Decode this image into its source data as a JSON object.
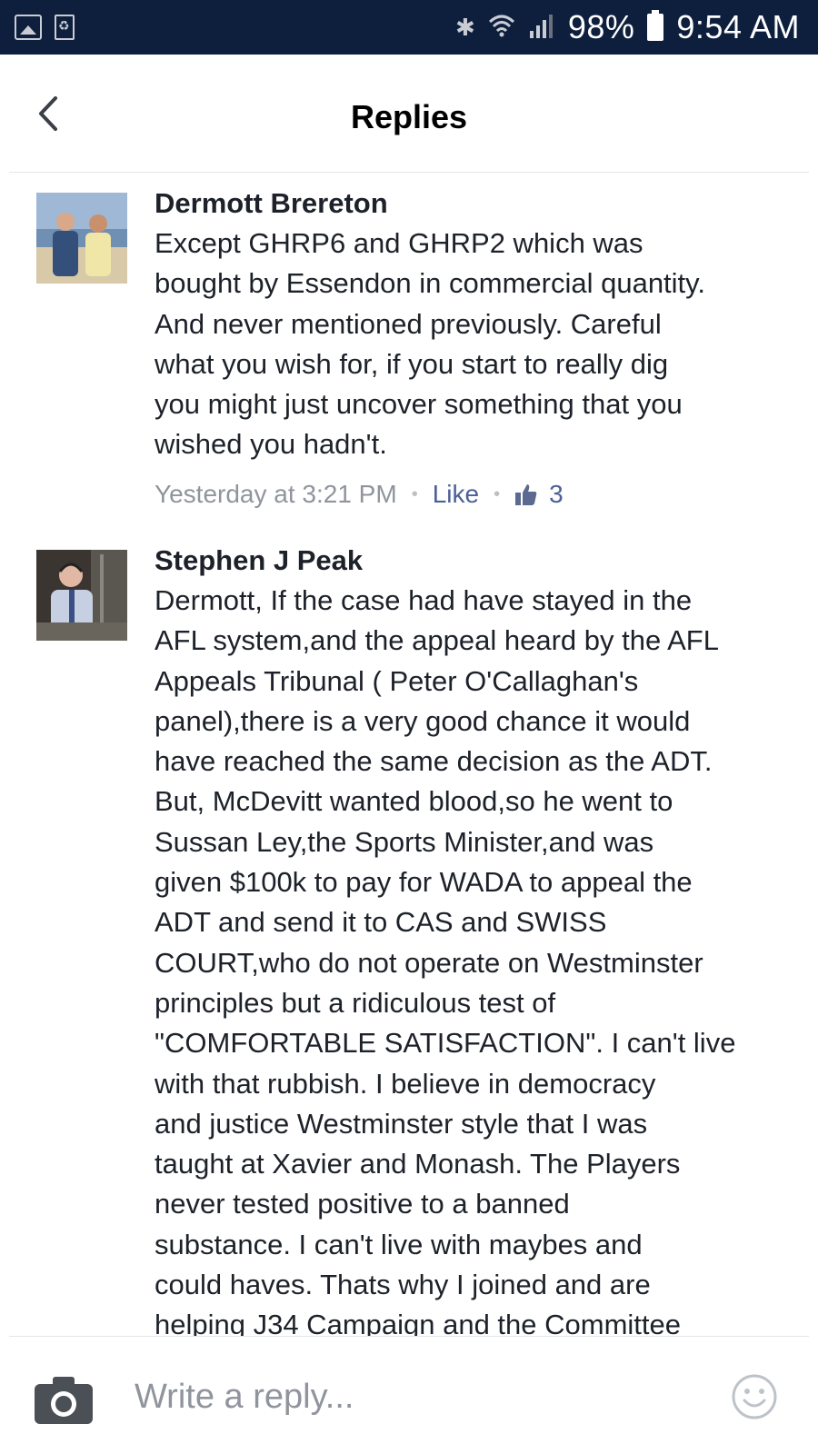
{
  "status_bar": {
    "battery": "98%",
    "time": "9:54 AM",
    "icons": [
      "gallery-icon",
      "recycle-icon",
      "bluetooth-icon",
      "wifi-icon",
      "signal-icon",
      "battery-icon"
    ]
  },
  "header": {
    "title": "Replies",
    "back_icon": "chevron-left-icon"
  },
  "comments": [
    {
      "author": "Dermott Brereton",
      "text": "Except GHRP6 and GHRP2 which was\nbought by Essendon in commercial quantity.\nAnd never mentioned previously. Careful\nwhat you wish for, if you start to really dig\nyou might just uncover something that you\nwished you hadn't.",
      "timestamp": "Yesterday at 3:21 PM",
      "like_label": "Like",
      "like_count": "3"
    },
    {
      "author": "Stephen J Peak",
      "text": "Dermott, If the case had have stayed in the\nAFL system,and the appeal heard by the AFL\nAppeals Tribunal ( Peter O'Callaghan's\npanel),there is a very good chance it would\nhave reached the same decision as the ADT.\nBut, McDevitt wanted blood,so he went to\nSussan Ley,the Sports Minister,and was\ngiven $100k to pay for WADA to appeal the\nADT and send it to CAS and SWISS\nCOURT,who do not operate on Westminster\nprinciples but a ridiculous test of\n\"COMFORTABLE SATISFACTION\". I can't live\nwith that rubbish. I believe in democracy\nand justice Westminster style that I was\ntaught at Xavier and Monash. The Players\nnever tested positive to a banned\nsubstance. I can't live with maybes and\ncould haves. Thats why I joined and are\nhelping J34 Campaign and the Committee"
    }
  ],
  "composer": {
    "placeholder": "Write a reply...",
    "camera_icon": "camera-icon",
    "emoji_icon": "smiley-icon"
  },
  "colors": {
    "status_bar": "#0e1f3d",
    "text_primary": "#1d2129",
    "text_secondary": "#90949c",
    "link_blue": "#4b6196",
    "divider": "#e4e6ea"
  }
}
